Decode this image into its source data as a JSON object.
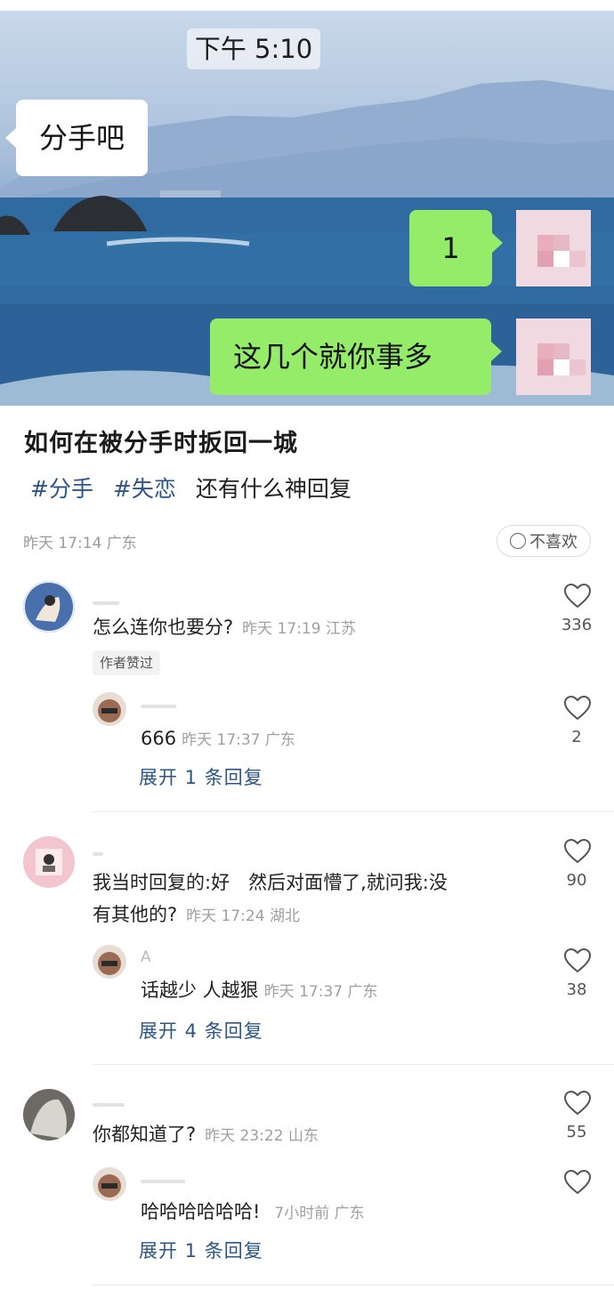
{
  "hero": {
    "time": "下午 5:10",
    "bubble_left": "分手吧",
    "bubble_right_1": "1",
    "bubble_right_2": "这几个就你事多"
  },
  "post": {
    "title": "如何在被分手时扳回一城",
    "tags": [
      "#分手",
      "#失恋"
    ],
    "tag_extra": "还有什么神回复",
    "meta": "昨天 17:14 广东",
    "dislike_label": "不喜欢"
  },
  "comments": [
    {
      "text": "怎么连你也要分?",
      "time": "昨天 17:19 江苏",
      "likes": "336",
      "badge": "作者赞过",
      "reply": {
        "text": "666",
        "time": "昨天 17:37 广东",
        "likes": "2"
      },
      "expand": "展开 1 条回复"
    },
    {
      "text_line1": "我当时回复的:好　然后对面懵了,就问我:没",
      "text_line2": "有其他的?",
      "time": "昨天 17:24 湖北",
      "likes": "90",
      "reply": {
        "name_initial": "A",
        "text": "话越少  人越狠",
        "time": "昨天 17:37 广东",
        "likes": "38"
      },
      "expand": "展开 4 条回复"
    },
    {
      "text": "你都知道了?",
      "time": "昨天 23:22 山东",
      "likes": "55",
      "reply": {
        "text": "哈哈哈哈哈哈!",
        "time": "7小时前 广东",
        "likes": ""
      },
      "expand": "展开 1 条回复"
    }
  ]
}
